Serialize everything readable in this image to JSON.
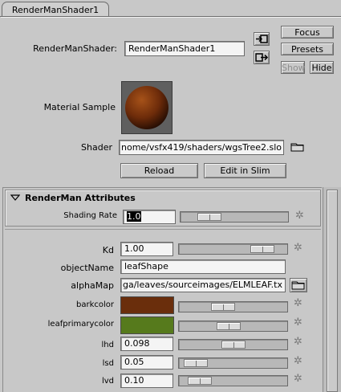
{
  "tab": {
    "label": "RenderManShader1"
  },
  "node": {
    "label": "RenderManShader:",
    "value": "RenderManShader1"
  },
  "buttons": {
    "focus": "Focus",
    "presets": "Presets",
    "show": "Show",
    "hide": "Hide",
    "reload": "Reload",
    "edit_in_slim": "Edit in Slim"
  },
  "material_sample": {
    "label": "Material Sample",
    "color": "#7a3410"
  },
  "shader": {
    "label": "Shader",
    "value": "nome/vsfx419/shaders/wgsTree2.slo"
  },
  "section": {
    "title": "RenderMan Attributes"
  },
  "shading_rate": {
    "label": "Shading Rate",
    "value": "1.0",
    "slider": 0.2
  },
  "attrs": {
    "kd": {
      "label": "Kd",
      "value": "1.00",
      "slider": 0.85
    },
    "object_name": {
      "label": "objectName",
      "value": "leafShape"
    },
    "alpha_map": {
      "label": "alphaMap",
      "value": "ga/leaves/sourceimages/ELMLEAF.tx"
    },
    "barkcolor": {
      "label": "barkcolor",
      "color": "#6a2e0c",
      "slider": 0.38
    },
    "leafprimarycolor": {
      "label": "leafprimarycolor",
      "color": "#567a1c",
      "slider": 0.45
    },
    "lhd": {
      "label": "lhd",
      "value": "0.098",
      "slider": 0.5
    },
    "lsd": {
      "label": "lsd",
      "value": "0.05",
      "slider": 0.05
    },
    "lvd": {
      "label": "lvd",
      "value": "0.10",
      "slider": 0.1
    }
  }
}
